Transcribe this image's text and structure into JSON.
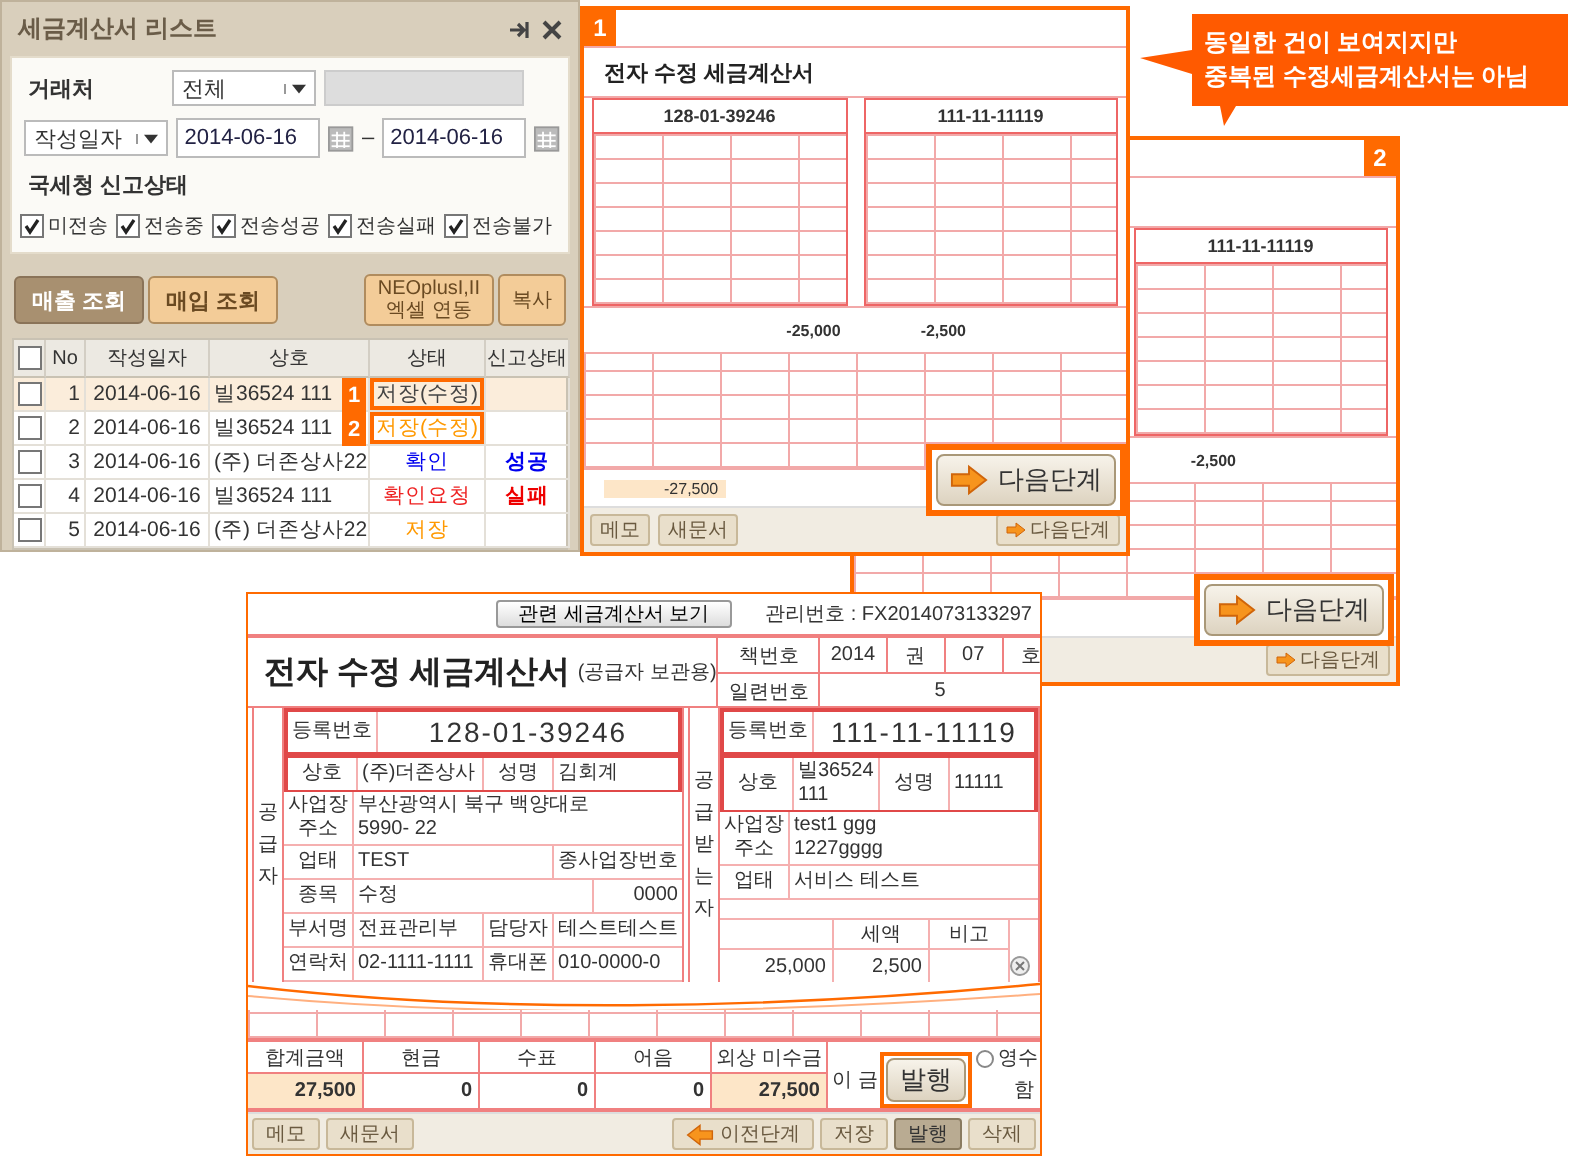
{
  "list_panel": {
    "title": "세금계산서 리스트",
    "filters": {
      "partner_label": "거래처",
      "partner_select": "전체",
      "date_type": "작성일자",
      "date_from": "2014-06-16",
      "separator": "–",
      "date_to": "2014-06-16"
    },
    "report_status": {
      "label": "국세청 신고상태",
      "options": [
        {
          "label": "미전송",
          "checked": true
        },
        {
          "label": "전송중",
          "checked": true
        },
        {
          "label": "전송성공",
          "checked": true
        },
        {
          "label": "전송실패",
          "checked": true
        },
        {
          "label": "전송불가",
          "checked": true
        }
      ]
    },
    "tabs": [
      {
        "label": "매출 조회",
        "selected": true
      },
      {
        "label": "매입 조회",
        "selected": false
      }
    ],
    "buttons": [
      "NEOplusI,II\n엑셀 연동",
      "복사"
    ],
    "table": {
      "select_all_checked": false,
      "columns": [
        "No",
        "작성일자",
        "상호",
        "상태",
        "신고상태"
      ],
      "rows": [
        {
          "checked": false,
          "selected": true,
          "no": "1",
          "date": "2014-06-16",
          "name": "빌36524 111",
          "marker": "1",
          "status": {
            "text": "저장(수정)",
            "color": "#444444"
          }
        },
        {
          "checked": false,
          "selected": false,
          "no": "2",
          "date": "2014-06-16",
          "name": "빌36524 111",
          "marker": "2",
          "status": {
            "text": "저장(수정)",
            "color": "#ff9900"
          }
        },
        {
          "checked": false,
          "selected": false,
          "no": "3",
          "date": "2014-06-16",
          "name": "(주) 더존상사22",
          "status": {
            "text": "확인",
            "color": "#0000ee"
          },
          "report": {
            "text": "성공",
            "color": "#0000ee"
          }
        },
        {
          "checked": false,
          "selected": false,
          "no": "4",
          "date": "2014-06-16",
          "name": "빌36524 111",
          "status": {
            "text": "확인요청",
            "color": "#ee2222"
          },
          "report": {
            "text": "실패",
            "color": "#ee0000"
          }
        },
        {
          "checked": false,
          "selected": false,
          "no": "5",
          "date": "2014-06-16",
          "name": "(주) 더존상사22",
          "status": {
            "text": "저장",
            "color": "#ff9900"
          }
        }
      ]
    }
  },
  "callout": {
    "text": "동일한 건이 보여지지만\n중복된 수정세금계산서는 아님"
  },
  "small_documents": [
    {
      "badge": "2",
      "receiver_reg": "111-11-11119",
      "tax": "-2,500",
      "next_button": "다음단계"
    },
    {
      "badge": "1",
      "title": "전자 수정 세금계산서",
      "supplier_reg": "128-01-39246",
      "receiver_reg": "111-11-11119",
      "supply_amount": "-25,000",
      "tax": "-2,500",
      "total": "-27,500",
      "footer_buttons": [
        "메모",
        "새문서"
      ],
      "next_button": "다음단계"
    }
  ],
  "zoom_buttons": [
    {
      "kind": "next",
      "label": "다음단계"
    },
    {
      "kind": "next",
      "label": "다음단계"
    },
    {
      "kind": "issue",
      "label": "발행"
    }
  ],
  "main_document": {
    "related_button": "관련 세금계산서 보기",
    "management_no": "관리번호 : FX2014073133297",
    "title": "전자 수정 세금계산서",
    "subtitle": "(공급자 보관용)",
    "book": [
      [
        "책번호",
        "2014",
        "권",
        "07",
        "호"
      ],
      [
        "일련번호",
        "5"
      ]
    ],
    "supplier": {
      "side_label": "공급자",
      "rows": [
        [
          {
            "kind": "label",
            "text": "등록번호"
          },
          {
            "kind": "big",
            "text": "128-01-39246"
          }
        ],
        [
          {
            "kind": "label",
            "text": "상호"
          },
          {
            "kind": "value",
            "text": "(주)더존상사"
          },
          {
            "kind": "label",
            "text": "성명"
          },
          {
            "kind": "value",
            "text": "김회계"
          }
        ],
        [
          {
            "kind": "label",
            "text": "사업장\n주소"
          },
          {
            "kind": "value",
            "text": "부산광역시 북구 백양대로\n5990- 22"
          }
        ],
        [
          {
            "kind": "label",
            "text": "업태"
          },
          {
            "kind": "value",
            "text": "TEST"
          },
          {
            "kind": "label",
            "text": "종사업장번호"
          }
        ],
        [
          {
            "kind": "label",
            "text": "종목"
          },
          {
            "kind": "value",
            "text": "수정"
          },
          {
            "kind": "number",
            "text": "0000"
          }
        ],
        [
          {
            "kind": "label",
            "text": "부서명"
          },
          {
            "kind": "value",
            "text": "전표관리부"
          },
          {
            "kind": "label",
            "text": "담당자"
          },
          {
            "kind": "value",
            "text": "테스트테스트"
          }
        ],
        [
          {
            "kind": "label",
            "text": "연락처"
          },
          {
            "kind": "value",
            "text": "02-1111-1111"
          },
          {
            "kind": "label",
            "text": "휴대폰"
          },
          {
            "kind": "value",
            "text": "010-0000-0"
          }
        ]
      ]
    },
    "receiver": {
      "side_label": "공급받는자",
      "rows": [
        [
          {
            "kind": "label",
            "text": "등록번호"
          },
          {
            "kind": "big",
            "text": "111-11-11119"
          }
        ],
        [
          {
            "kind": "label",
            "text": "상호"
          },
          {
            "kind": "value",
            "text": "빌36524 111"
          },
          {
            "kind": "label",
            "text": "성명"
          },
          {
            "kind": "value",
            "text": "11111"
          }
        ],
        [
          {
            "kind": "label",
            "text": "사업장\n주소"
          },
          {
            "kind": "value",
            "text": "test1 ggg\n1227gggg"
          }
        ],
        [
          {
            "kind": "label",
            "text": "업태"
          },
          {
            "kind": "value",
            "text": "서비스 테스트"
          }
        ]
      ]
    },
    "item_fragment": {
      "headers": [
        "세액",
        "비고"
      ],
      "values": [
        "25,000",
        "2,500"
      ]
    },
    "totals": {
      "headers": [
        "합계금액",
        "현금",
        "수표",
        "어음",
        "외상 미수금"
      ],
      "values": [
        "27,500",
        "0",
        "0",
        "0",
        "27,500"
      ]
    },
    "receipt": {
      "prefix": "이 금",
      "option": "영수",
      "option_selected": false,
      "suffix": "함"
    },
    "footer_left": [
      "메모",
      "새문서"
    ],
    "footer_right": [
      {
        "label": "이전단계",
        "kind": "back",
        "selected": false
      },
      {
        "label": "저장",
        "kind": "plain",
        "selected": false
      },
      {
        "label": "발행",
        "kind": "plain",
        "selected": true
      },
      {
        "label": "삭제",
        "kind": "plain",
        "selected": false
      }
    ]
  }
}
